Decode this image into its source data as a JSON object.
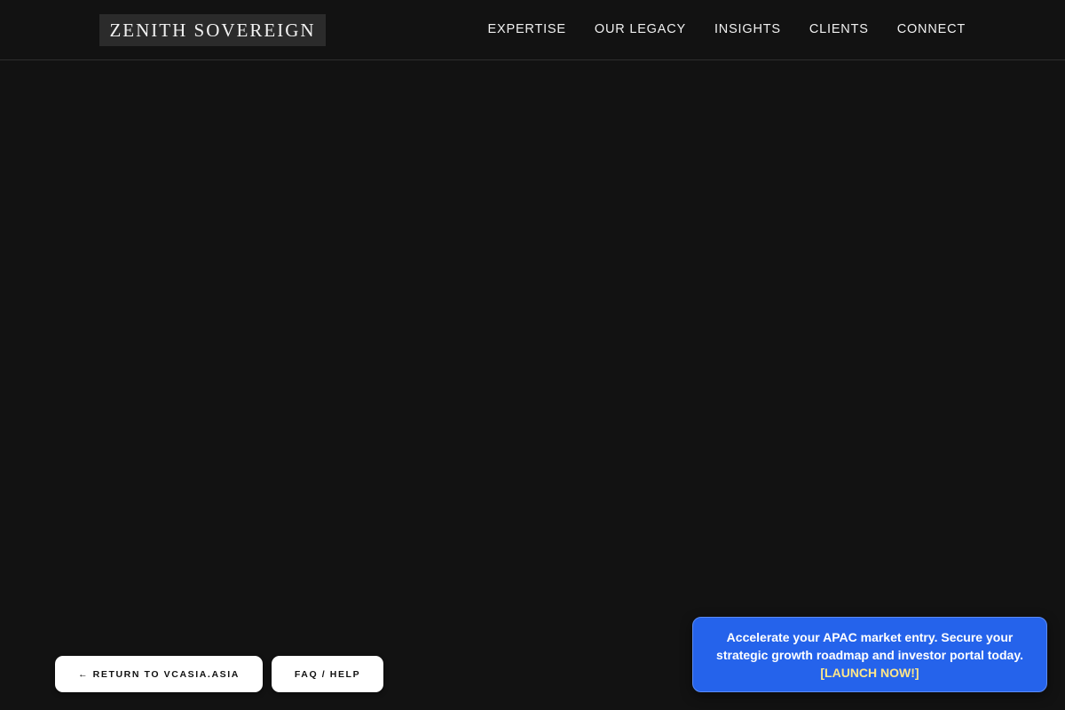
{
  "header": {
    "logo_text": "ZENITH SOVEREIGN",
    "nav": [
      {
        "label": "EXPERTISE"
      },
      {
        "label": "OUR LEGACY"
      },
      {
        "label": "INSIGHTS"
      },
      {
        "label": "CLIENTS"
      },
      {
        "label": "CONNECT"
      }
    ]
  },
  "footer_buttons": {
    "return_label": "← RETURN TO VCASIA.ASIA",
    "faq_label": "FAQ / HELP"
  },
  "promo": {
    "message": "Accelerate your APAC market entry. Secure your strategic growth roadmap and investor portal today.",
    "cta_label": "[LAUNCH NOW!]"
  },
  "colors": {
    "background": "#121212",
    "promo_accent": "#2563eb",
    "cta_text": "#fde68a"
  }
}
